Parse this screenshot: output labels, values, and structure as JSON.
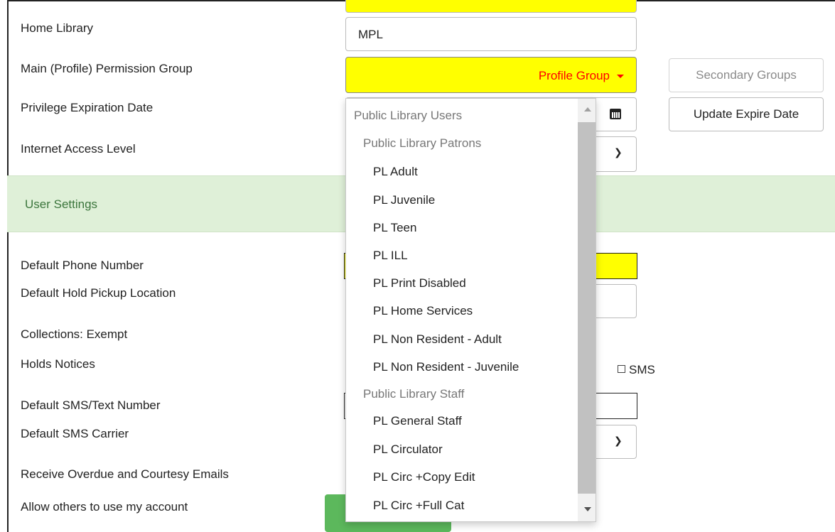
{
  "form": {
    "home_library_label": "Home Library",
    "home_library_value": "MPL",
    "permission_group_label": "Main (Profile) Permission Group",
    "permission_group_value": "Profile Group",
    "expiration_label": "Privilege Expiration Date",
    "internet_access_label": "Internet Access Level"
  },
  "buttons": {
    "secondary_groups": "Secondary Groups",
    "update_expire": "Update Expire Date"
  },
  "section": {
    "user_settings": "User Settings"
  },
  "settings": {
    "phone_label": "Default Phone Number",
    "pickup_label": "Default Hold Pickup Location",
    "collections_label": "Collections: Exempt",
    "holds_label": "Holds Notices",
    "sms_checkbox_label": "SMS",
    "sms_number_label": "Default SMS/Text Number",
    "sms_carrier_label": "Default SMS Carrier",
    "overdue_label": "Receive Overdue and Courtesy Emails",
    "allow_others_label": "Allow others to use my account"
  },
  "dropdown": {
    "group_heading": "Public Library Users",
    "patrons_heading": "Public Library Patrons",
    "patron_options": [
      "PL Adult",
      "PL Juvenile",
      "PL Teen",
      "PL ILL",
      "PL Print Disabled",
      "PL Home Services",
      "PL Non Resident - Adult",
      "PL Non Resident - Juvenile"
    ],
    "staff_heading": "Public Library Staff",
    "staff_options": [
      "PL General Staff",
      "PL Circulator",
      "PL Circ +Copy Edit",
      "PL Circ +Full Cat"
    ]
  },
  "colors": {
    "required_field": "#ffff00",
    "group_value_text": "#ff0000",
    "section_bg": "#dff0d8",
    "section_text": "#3c763d"
  },
  "icons": {
    "calendar": "calendar-icon",
    "chevron": "chevron-down-icon",
    "caret": "caret-down-icon"
  }
}
